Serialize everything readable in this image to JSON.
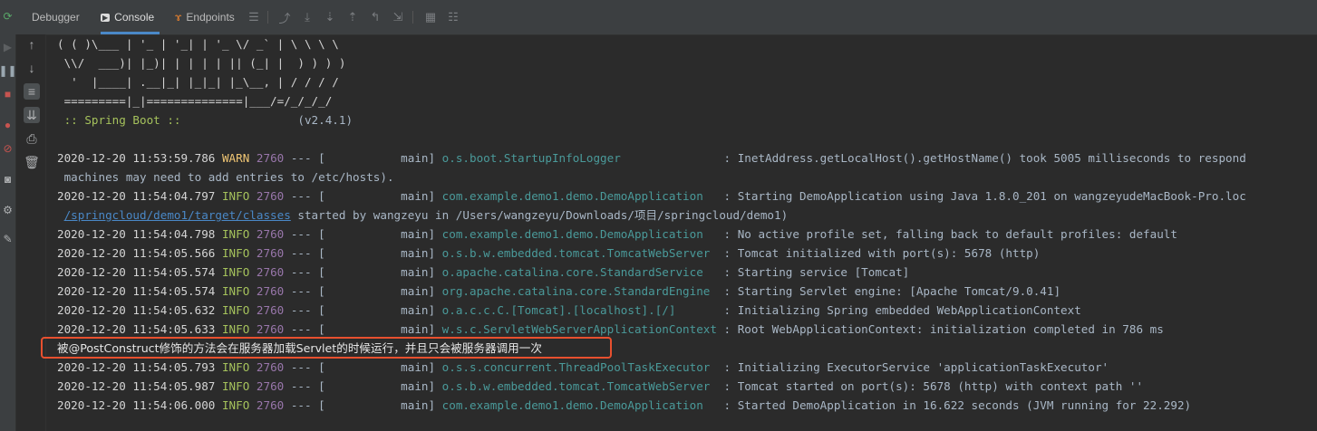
{
  "tabs": {
    "debugger": "Debugger",
    "console": "Console",
    "endpoints": "Endpoints"
  },
  "banner": [
    "( ( )\\___ | '_ | '_| | '_ \\/ _` | \\ \\ \\ \\",
    " \\\\/  ___)| |_)| | | | | || (_| |  ) ) ) )",
    "  '  |____| .__|_| |_|_| |_\\__, | / / / /",
    " =========|_|==============|___/=/_/_/_/"
  ],
  "spring_boot": {
    "label": " :: Spring Boot ::",
    "version": "(v2.4.1)"
  },
  "logs": [
    {
      "ts": "2020-12-20 11:53:59.786",
      "level": " WARN",
      "pid": "2760",
      "sep": " --- [",
      "thread": "           main] ",
      "logger": "o.s.boot.StartupInfoLogger              ",
      "msg": " : InetAddress.getLocalHost().getHostName() took 5005 milliseconds to respond"
    },
    {
      "cont": " machines may need to add entries to /etc/hosts)."
    },
    {
      "ts": "2020-12-20 11:54:04.797",
      "level": " INFO",
      "pid": "2760",
      "sep": " --- [",
      "thread": "           main] ",
      "logger": "com.example.demo1.demo.DemoApplication  ",
      "msg": " : Starting DemoApplication using Java 1.8.0_201 on wangzeyudeMacBook-Pro.loc"
    },
    {
      "cont_link": "/springcloud/demo1/target/classes",
      "cont_rest": " started by wangzeyu in /Users/wangzeyu/Downloads/项目/springcloud/demo1)"
    },
    {
      "ts": "2020-12-20 11:54:04.798",
      "level": " INFO",
      "pid": "2760",
      "sep": " --- [",
      "thread": "           main] ",
      "logger": "com.example.demo1.demo.DemoApplication  ",
      "msg": " : No active profile set, falling back to default profiles: default"
    },
    {
      "ts": "2020-12-20 11:54:05.566",
      "level": " INFO",
      "pid": "2760",
      "sep": " --- [",
      "thread": "           main] ",
      "logger": "o.s.b.w.embedded.tomcat.TomcatWebServer ",
      "msg": " : Tomcat initialized with port(s): 5678 (http)"
    },
    {
      "ts": "2020-12-20 11:54:05.574",
      "level": " INFO",
      "pid": "2760",
      "sep": " --- [",
      "thread": "           main] ",
      "logger": "o.apache.catalina.core.StandardService  ",
      "msg": " : Starting service [Tomcat]"
    },
    {
      "ts": "2020-12-20 11:54:05.574",
      "level": " INFO",
      "pid": "2760",
      "sep": " --- [",
      "thread": "           main] ",
      "logger": "org.apache.catalina.core.StandardEngine ",
      "msg": " : Starting Servlet engine: [Apache Tomcat/9.0.41]"
    },
    {
      "ts": "2020-12-20 11:54:05.632",
      "level": " INFO",
      "pid": "2760",
      "sep": " --- [",
      "thread": "           main] ",
      "logger": "o.a.c.c.C.[Tomcat].[localhost].[/]      ",
      "msg": " : Initializing Spring embedded WebApplicationContext"
    },
    {
      "ts": "2020-12-20 11:54:05.633",
      "level": " INFO",
      "pid": "2760",
      "sep": " --- [",
      "thread": "           main] ",
      "logger": "w.s.c.ServletWebServerApplicationContext",
      "msg": " : Root WebApplicationContext: initialization completed in 786 ms"
    },
    {
      "note": "被@PostConstruct修饰的方法会在服务器加载Servlet的时候运行，并且只会被服务器调用一次"
    },
    {
      "ts": "2020-12-20 11:54:05.793",
      "level": " INFO",
      "pid": "2760",
      "sep": " --- [",
      "thread": "           main] ",
      "logger": "o.s.s.concurrent.ThreadPoolTaskExecutor ",
      "msg": " : Initializing ExecutorService 'applicationTaskExecutor'"
    },
    {
      "ts": "2020-12-20 11:54:05.987",
      "level": " INFO",
      "pid": "2760",
      "sep": " --- [",
      "thread": "           main] ",
      "logger": "o.s.b.w.embedded.tomcat.TomcatWebServer ",
      "msg": " : Tomcat started on port(s): 5678 (http) with context path ''"
    },
    {
      "ts": "2020-12-20 11:54:06.000",
      "level": " INFO",
      "pid": "2760",
      "sep": " --- [",
      "thread": "           main] ",
      "logger": "com.example.demo1.demo.DemoApplication  ",
      "msg": " : Started DemoApplication in 16.622 seconds (JVM running for 22.292)"
    }
  ],
  "colors": {
    "background": "#2b2b2b",
    "warn": "#f0c674",
    "info": "#a5c25c",
    "pid": "#9876aa",
    "logger": "#4a9a9a",
    "highlight": "#e8502f"
  }
}
